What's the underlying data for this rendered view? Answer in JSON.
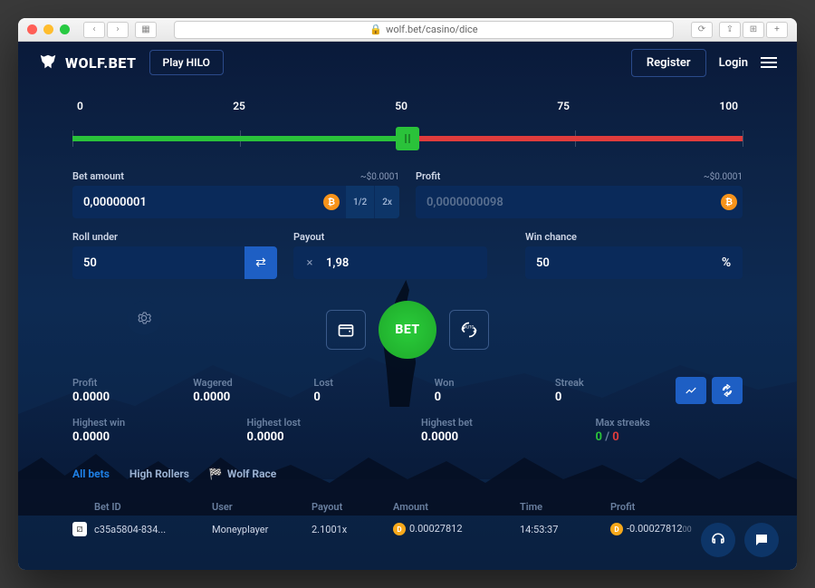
{
  "browser": {
    "url": "wolf.bet/casino/dice"
  },
  "header": {
    "brand": "WOLF.BET",
    "play_button": "Play HILO",
    "register": "Register",
    "login": "Login"
  },
  "slider": {
    "ticks": [
      "0",
      "25",
      "50",
      "75",
      "100"
    ],
    "value": 50
  },
  "bet": {
    "amount_label": "Bet amount",
    "amount_hint": "~$0.0001",
    "amount_value": "0,00000001",
    "half_label": "1/2",
    "double_label": "2x",
    "profit_label": "Profit",
    "profit_hint": "~$0.0001",
    "profit_placeholder": "0,0000000098",
    "roll_label": "Roll under",
    "roll_value": "50",
    "payout_label": "Payout",
    "payout_value": "1,98",
    "winchance_label": "Win chance",
    "winchance_value": "50",
    "bet_button": "BET"
  },
  "stats": {
    "profit_label": "Profit",
    "profit_value": "0.0000",
    "wagered_label": "Wagered",
    "wagered_value": "0.0000",
    "lost_label": "Lost",
    "lost_value": "0",
    "won_label": "Won",
    "won_value": "0",
    "streak_label": "Streak",
    "streak_value": "0",
    "highwin_label": "Highest win",
    "highwin_value": "0.0000",
    "highlost_label": "Highest lost",
    "highlost_value": "0.0000",
    "highbet_label": "Highest bet",
    "highbet_value": "0.0000",
    "maxstreaks_label": "Max streaks",
    "maxstreaks_win": "0",
    "maxstreaks_sep": " / ",
    "maxstreaks_loss": "0"
  },
  "tabs": {
    "all_bets": "All bets",
    "high_rollers": "High Rollers",
    "wolf_race": "Wolf Race"
  },
  "table": {
    "headers": {
      "betid": "Bet ID",
      "user": "User",
      "payout": "Payout",
      "amount": "Amount",
      "time": "Time",
      "profit": "Profit"
    },
    "row": {
      "betid": "c35a5804-834...",
      "user": "Moneyplayer",
      "payout": "2.1001x",
      "amount": "0.00027812",
      "time": "14:53:37",
      "profit": "-0.00027812",
      "profit_suffix": "00"
    }
  }
}
